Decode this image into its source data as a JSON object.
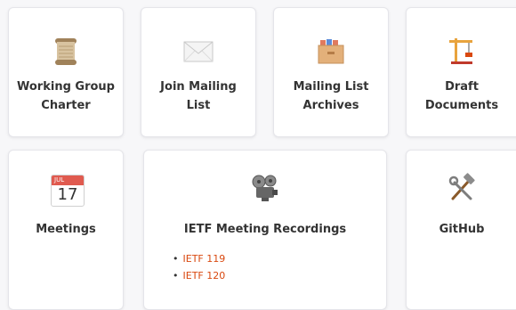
{
  "cards": {
    "charter": {
      "title_line1": "Working Group",
      "title_line2": "Charter",
      "icon": "scroll-icon"
    },
    "join": {
      "title_line1": "Join Mailing",
      "title_line2": "List",
      "icon": "envelope-icon"
    },
    "archives": {
      "title_line1": "Mailing List",
      "title_line2": "Archives",
      "icon": "file-drawer-icon"
    },
    "drafts": {
      "title_line1": "Draft",
      "title_line2": "Documents",
      "icon": "construction-crane-icon"
    },
    "meetings": {
      "title": "Meetings",
      "icon": "calendar-icon",
      "calendar_month": "JUL",
      "calendar_day": "17"
    },
    "recordings": {
      "title": "IETF Meeting Recordings",
      "icon": "film-projector-icon",
      "links": [
        "IETF 119",
        "IETF 120"
      ]
    },
    "github": {
      "title": "GitHub",
      "icon": "hammer-and-wrench-icon"
    }
  },
  "colors": {
    "link": "#d9480f",
    "card_border": "#e5e5ea",
    "page_bg": "#f7f7f9"
  }
}
